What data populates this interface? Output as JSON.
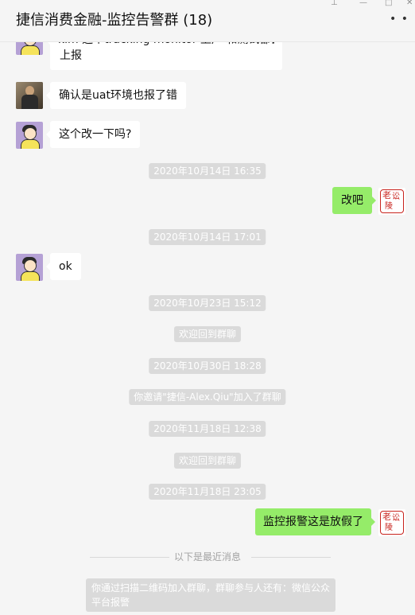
{
  "window": {
    "title": "捷信消费金融-监控告警群 (18)",
    "pin_icon": "pin-icon",
    "minimize_icon": "minimize-icon",
    "maximize_icon": "maximize-icon",
    "close_icon": "close-icon",
    "more_icon": "more-icon"
  },
  "messages": [
    {
      "side": "left",
      "avatar": "girl-avatar",
      "lines": [
        "kim 这个tracking monitor 上产 和测试都会",
        "上报"
      ]
    },
    {
      "side": "left",
      "avatar": "man-avatar",
      "text": "确认是uat环境也报了错"
    },
    {
      "side": "left",
      "avatar": "girl-avatar",
      "text": "这个改一下吗?"
    },
    {
      "type": "time",
      "text": "2020年10月14日 16:35"
    },
    {
      "side": "right",
      "avatar": "seal-avatar",
      "text": "改吧"
    },
    {
      "type": "time",
      "text": "2020年10月14日 17:01"
    },
    {
      "side": "left",
      "avatar": "girl-avatar",
      "text": "ok"
    },
    {
      "type": "time",
      "text": "2020年10月23日 15:12"
    },
    {
      "type": "system",
      "text": "欢迎回到群聊"
    },
    {
      "type": "time",
      "text": "2020年10月30日 18:28"
    },
    {
      "type": "system",
      "text": "你邀请\"捷信-Alex.Qiu\"加入了群聊"
    },
    {
      "type": "time",
      "text": "2020年11月18日 12:38"
    },
    {
      "type": "system",
      "text": "欢迎回到群聊"
    },
    {
      "type": "time",
      "text": "2020年11月18日 23:05"
    },
    {
      "side": "right",
      "avatar": "seal-avatar",
      "text": "监控报警这是放假了"
    }
  ],
  "divider": {
    "text": "以下是最近消息"
  },
  "footer_note": {
    "text": "你通过扫描二维码加入群聊，群聊参与人还有：微信公众平台报警"
  },
  "colors": {
    "background": "#f5f5f5",
    "mine_bubble": "#95ec69",
    "other_bubble": "#ffffff",
    "system_pill": "#dadada"
  }
}
